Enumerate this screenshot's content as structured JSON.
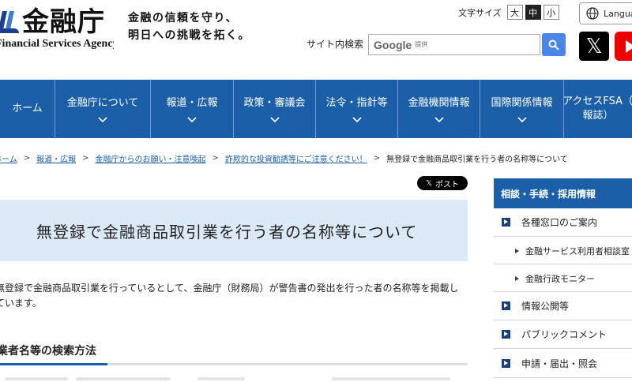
{
  "header": {
    "logo_title": "金融庁",
    "logo_english": "Financial Services Agency",
    "tagline_line1": "金融の信頼を守り、",
    "tagline_line2": "明日への挑戦を拓く。",
    "font_size_label": "文字サイズ",
    "font_sizes": [
      "大",
      "中",
      "小"
    ],
    "language_label": "Language",
    "search_label": "サイト内検索",
    "search_google": "Google",
    "search_provided": "提供"
  },
  "nav": {
    "items": [
      {
        "line1": "ホーム",
        "line2": ""
      },
      {
        "line1": "金融庁について",
        "line2": ""
      },
      {
        "line1": "報道・広報",
        "line2": ""
      },
      {
        "line1": "政策・審議会",
        "line2": ""
      },
      {
        "line1": "法令・指針等",
        "line2": ""
      },
      {
        "line1": "金融機関情報",
        "line2": ""
      },
      {
        "line1": "国際関係情報",
        "line2": ""
      },
      {
        "line1": "アクセスFSA（広",
        "line2": "報誌）"
      }
    ]
  },
  "breadcrumb": {
    "items": [
      "ホーム",
      "報道・広報",
      "金融庁からのお願い・注意喚起",
      "詐欺的な投資勧誘等にご注意ください！"
    ],
    "current": "無登録で金融商品取引業を行う者の名称等について"
  },
  "share": {
    "post_label": "ポスト"
  },
  "main": {
    "title": "無登録で金融商品取引業を行う者の名称等について",
    "intro": "無登録で金融商品取引業を行っているとして、金融庁（財務局）が警告書の発出を行った者の名称等を掲載しています。",
    "section_heading": "業者名等の検索方法"
  },
  "sidebar": {
    "heading": "相談・手続・採用情報",
    "items": [
      {
        "type": "item",
        "label": "各種窓口のご案内"
      },
      {
        "type": "sub",
        "label": "金融サービス利用者相談室"
      },
      {
        "type": "sub",
        "label": "金融行政モニター"
      },
      {
        "type": "item",
        "label": "情報公開等"
      },
      {
        "type": "item",
        "label": "パブリックコメント"
      },
      {
        "type": "item",
        "label": "申請・届出・照会"
      }
    ]
  },
  "colors": {
    "nav_blue": "#1a5fa8",
    "title_bg": "#dbe8f6",
    "bullet": "#1a3f7a"
  }
}
